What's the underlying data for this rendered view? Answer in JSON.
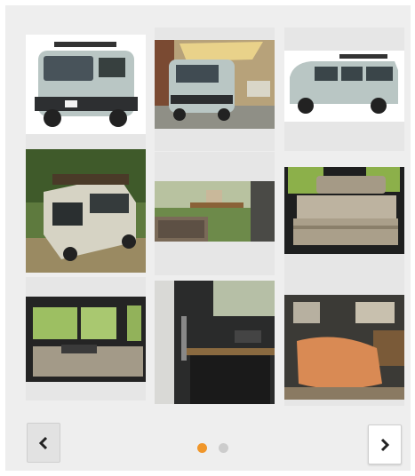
{
  "carousel": {
    "prev_icon": "chevron-left-icon",
    "next_icon": "chevron-right-icon",
    "active_page": 1,
    "page_count": 2
  },
  "colors": {
    "dot_active": "#f0962a",
    "dot_inactive": "#cccccc",
    "background": "#eeeeee",
    "van_body": "#b9c6c4"
  },
  "thumbnails": [
    {
      "subject": "van-front-studio"
    },
    {
      "subject": "van-parked-awning"
    },
    {
      "subject": "van-side-studio"
    },
    {
      "subject": "van-rear-forest"
    },
    {
      "subject": "van-interior-table"
    },
    {
      "subject": "van-interior-seats"
    },
    {
      "subject": "van-interior-bed-flat"
    },
    {
      "subject": "van-interior-kitchen"
    },
    {
      "subject": "van-interior-mattress"
    }
  ]
}
